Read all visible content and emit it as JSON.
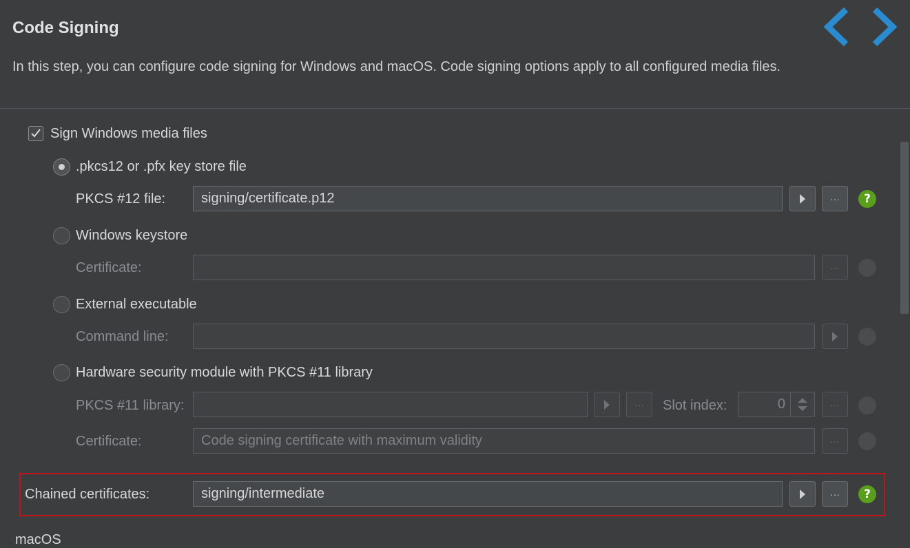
{
  "header": {
    "title": "Code Signing",
    "description": "In this step, you can configure code signing for Windows and macOS. Code signing options apply to all configured media files."
  },
  "nav": {
    "back_icon": "chevron-left",
    "forward_icon": "chevron-right",
    "accent_color": "#2a8ccf"
  },
  "windows": {
    "sign_label": "Sign Windows media files",
    "sign_checked": true,
    "pkcs12": {
      "option_label": ".pkcs12 or .pfx key store file",
      "selected": true,
      "field_label": "PKCS #12 file:",
      "field_value": "signing/certificate.p12"
    },
    "keystore": {
      "option_label": "Windows keystore",
      "selected": false,
      "field_label": "Certificate:",
      "field_value": ""
    },
    "external": {
      "option_label": "External executable",
      "selected": false,
      "field_label": "Command line:",
      "field_value": ""
    },
    "hsm": {
      "option_label": "Hardware security module with PKCS #11 library",
      "selected": false,
      "library_label": "PKCS #11 library:",
      "library_value": "",
      "slot_label": "Slot index:",
      "slot_value": "0",
      "cert_label": "Certificate:",
      "cert_placeholder": "Code signing certificate with maximum validity"
    },
    "chained": {
      "field_label": "Chained certificates:",
      "field_value": "signing/intermediate"
    }
  },
  "buttons": {
    "browse": "···",
    "help": "?"
  },
  "macos": {
    "section_label": "macOS"
  },
  "colors": {
    "help_green": "#5a9e1e",
    "highlight_red": "#c0141b",
    "background": "#3b3d3f"
  }
}
